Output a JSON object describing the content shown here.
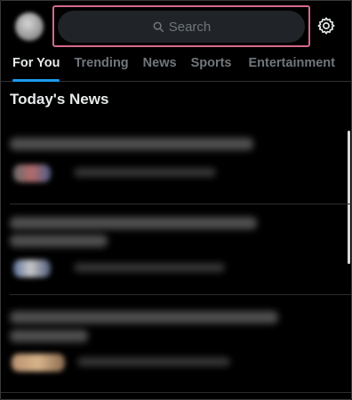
{
  "header": {
    "search_placeholder": "Search",
    "search_icon": "search-icon",
    "settings_icon": "gear-icon"
  },
  "tabs": [
    {
      "label": "For You",
      "active": true
    },
    {
      "label": "Trending",
      "active": false
    },
    {
      "label": "News",
      "active": false
    },
    {
      "label": "Sports",
      "active": false
    },
    {
      "label": "Entertainment",
      "active": false
    }
  ],
  "section": {
    "title": "Today's News"
  },
  "colors": {
    "background": "#000000",
    "accent": "#1d9bf0",
    "highlight_border": "#d46a8a",
    "search_bg": "#202327"
  }
}
